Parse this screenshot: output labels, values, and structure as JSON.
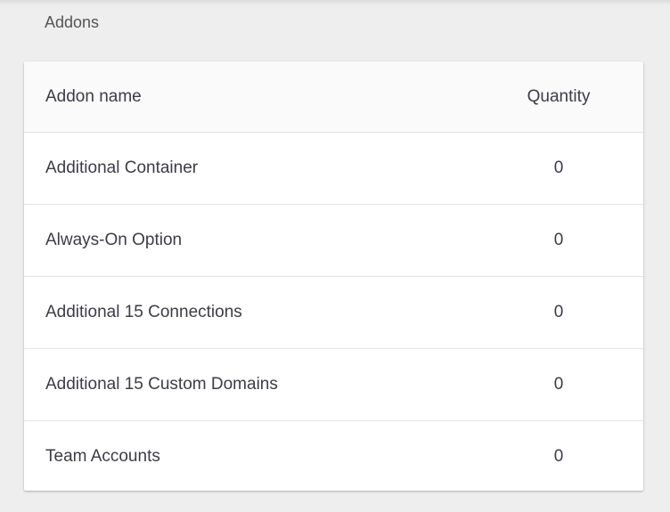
{
  "section": {
    "title": "Addons"
  },
  "table": {
    "headers": {
      "name": "Addon name",
      "quantity": "Quantity"
    },
    "rows": [
      {
        "name": "Additional Container",
        "quantity": "0"
      },
      {
        "name": "Always-On Option",
        "quantity": "0"
      },
      {
        "name": "Additional 15 Connections",
        "quantity": "0"
      },
      {
        "name": "Additional 15 Custom Domains",
        "quantity": "0"
      },
      {
        "name": "Team Accounts",
        "quantity": "0"
      }
    ]
  }
}
